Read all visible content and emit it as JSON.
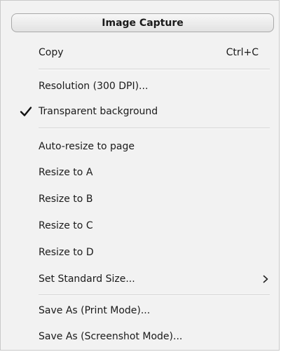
{
  "menu": {
    "title": "Image Capture",
    "items": [
      {
        "label": "Copy",
        "shortcut": "Ctrl+C"
      },
      {
        "label": "Resolution (300 DPI)..."
      },
      {
        "label": "Transparent background",
        "checked": true
      },
      {
        "label": "Auto-resize to page"
      },
      {
        "label": "Resize to A"
      },
      {
        "label": "Resize to B"
      },
      {
        "label": "Resize to C"
      },
      {
        "label": "Resize to D"
      },
      {
        "label": "Set Standard Size...",
        "submenu": true
      },
      {
        "label": "Save As (Print Mode)..."
      },
      {
        "label": "Save As (Screenshot Mode)..."
      }
    ]
  },
  "icons": {
    "check": "checkmark-icon",
    "submenu": "chevron-right-icon"
  }
}
